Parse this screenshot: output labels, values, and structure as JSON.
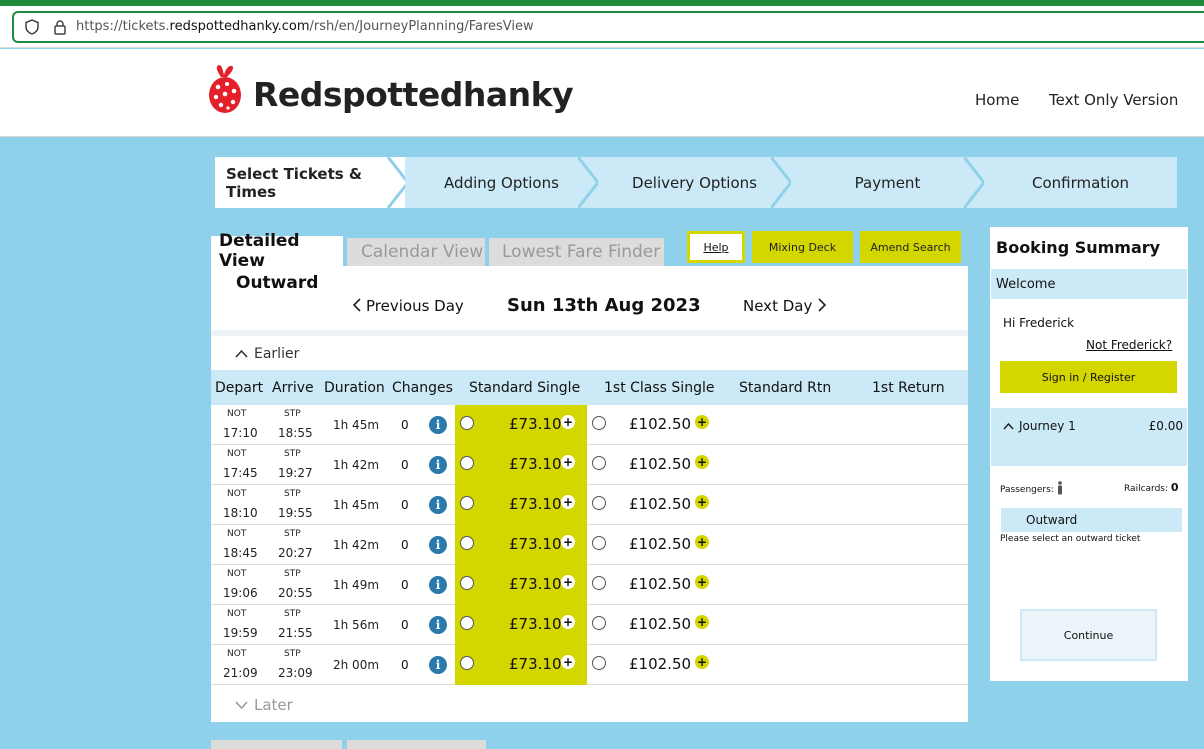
{
  "browser": {
    "url_prefix": "https://tickets.",
    "url_domain": "redspottedhanky.com",
    "url_path": "/rsh/en/JourneyPlanning/FaresView"
  },
  "header": {
    "logo_text": "Redspottedhanky",
    "nav_home": "Home",
    "nav_text_only": "Text Only Version"
  },
  "steps": [
    "Select Tickets & Times",
    "Adding Options",
    "Delivery Options",
    "Payment",
    "Confirmation"
  ],
  "tabs": {
    "detailed": "Detailed View",
    "calendar": "Calendar View",
    "lowest": "Lowest Fare Finder"
  },
  "buttons": {
    "help": "Help",
    "mixing": "Mixing Deck",
    "amend": "Amend Search"
  },
  "journey": {
    "outward": "Outward",
    "prev_day": "Previous Day",
    "date": "Sun 13th Aug 2023",
    "next_day": "Next Day",
    "earlier": "Earlier",
    "later": "Later"
  },
  "columns": [
    "Depart",
    "Arrive",
    "Duration",
    "Changes",
    "Standard Single",
    "1st Class Single",
    "Standard Rtn",
    "1st Return"
  ],
  "rows": [
    {
      "from": "NOT",
      "dep": "17:10",
      "to": "STP",
      "arr": "18:55",
      "duration": "1h 45m",
      "changes": "0",
      "std": "£73.10",
      "first": "£102.50"
    },
    {
      "from": "NOT",
      "dep": "17:45",
      "to": "STP",
      "arr": "19:27",
      "duration": "1h 42m",
      "changes": "0",
      "std": "£73.10",
      "first": "£102.50"
    },
    {
      "from": "NOT",
      "dep": "18:10",
      "to": "STP",
      "arr": "19:55",
      "duration": "1h 45m",
      "changes": "0",
      "std": "£73.10",
      "first": "£102.50"
    },
    {
      "from": "NOT",
      "dep": "18:45",
      "to": "STP",
      "arr": "20:27",
      "duration": "1h 42m",
      "changes": "0",
      "std": "£73.10",
      "first": "£102.50"
    },
    {
      "from": "NOT",
      "dep": "19:06",
      "to": "STP",
      "arr": "20:55",
      "duration": "1h 49m",
      "changes": "0",
      "std": "£73.10",
      "first": "£102.50"
    },
    {
      "from": "NOT",
      "dep": "19:59",
      "to": "STP",
      "arr": "21:55",
      "duration": "1h 56m",
      "changes": "0",
      "std": "£73.10",
      "first": "£102.50"
    },
    {
      "from": "NOT",
      "dep": "21:09",
      "to": "STP",
      "arr": "23:09",
      "duration": "2h 00m",
      "changes": "0",
      "std": "£73.10",
      "first": "£102.50"
    }
  ],
  "summary": {
    "title": "Booking Summary",
    "welcome": "Welcome",
    "hi": "Hi Frederick",
    "not_user": "Not Frederick?",
    "sign_in": "Sign in / Register",
    "journey_label": "Journey 1",
    "journey_price": "£0.00",
    "passengers": "Passengers:",
    "railcards": "Railcards:",
    "railcards_count": "0",
    "outward": "Outward",
    "select_msg": "Please select an outward ticket",
    "continue": "Continue"
  },
  "colors": {
    "accent_yellow": "#d4d600",
    "light_blue": "#cbe9f6",
    "page_blue": "#8fd0ea",
    "brand_red": "#e4202a",
    "info_blue": "#2c7aab"
  }
}
